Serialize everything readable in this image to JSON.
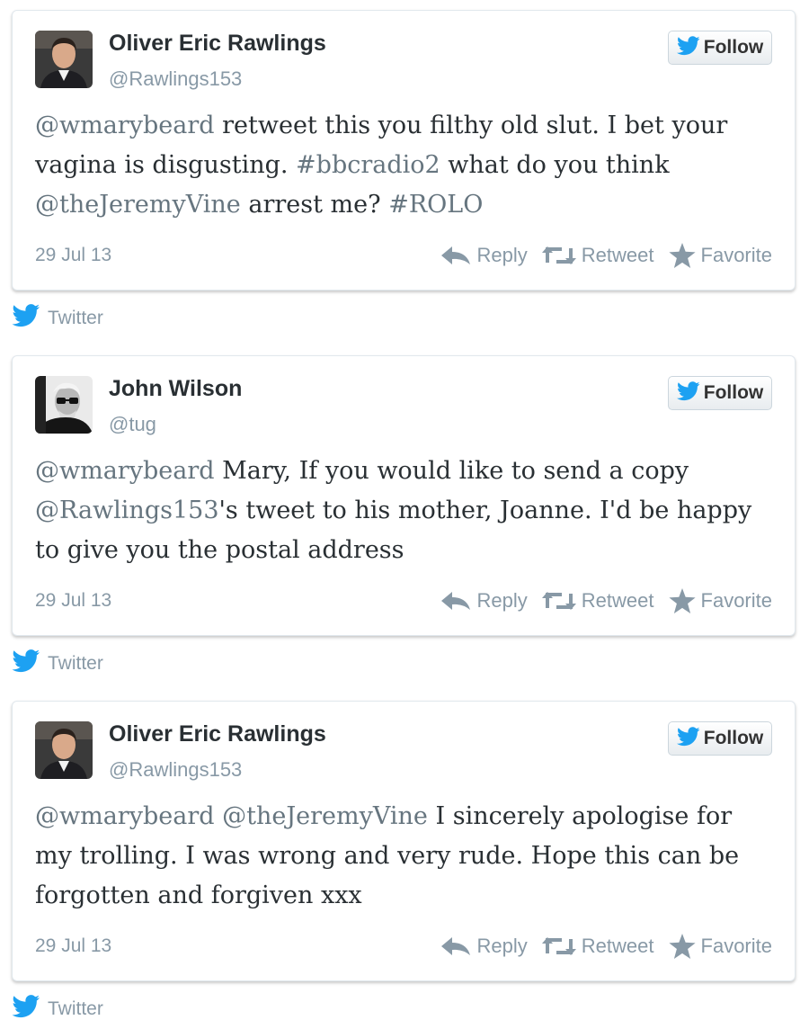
{
  "colors": {
    "twitter_blue": "#1da1f2",
    "text": "#292f33",
    "muted": "#8899a6",
    "link_gray": "#66757f"
  },
  "tweets": [
    {
      "name": "Oliver Eric Rawlings",
      "handle": "@Rawlings153",
      "follow_label": "Follow",
      "segments": [
        {
          "t": "@wmarybeard",
          "k": "mention"
        },
        {
          "t": " retweet this you filthy old slut. I bet your vagina is disgusting. ",
          "k": "plain"
        },
        {
          "t": "#bbcradio2",
          "k": "hashtag"
        },
        {
          "t": " what do you think ",
          "k": "plain"
        },
        {
          "t": "@theJeremyVine",
          "k": "mention"
        },
        {
          "t": " arrest me? ",
          "k": "plain"
        },
        {
          "t": "#ROLO",
          "k": "hashtag"
        }
      ],
      "date": "29 Jul 13",
      "reply_label": "Reply",
      "retweet_label": "Retweet",
      "favorite_label": "Favorite",
      "source_label": "Twitter",
      "avatar_icon": "young-man-avatar"
    },
    {
      "name": "John Wilson",
      "handle": "@tug",
      "follow_label": "Follow",
      "segments": [
        {
          "t": "@wmarybeard",
          "k": "mention"
        },
        {
          "t": " Mary, If you would like to send a copy ",
          "k": "plain"
        },
        {
          "t": "@Rawlings153",
          "k": "mention"
        },
        {
          "t": "'s tweet to his mother, Joanne. I'd be happy to give you the postal address",
          "k": "plain"
        }
      ],
      "date": "29 Jul 13",
      "reply_label": "Reply",
      "retweet_label": "Retweet",
      "favorite_label": "Favorite",
      "source_label": "Twitter",
      "avatar_icon": "bw-man-glasses-avatar"
    },
    {
      "name": "Oliver Eric Rawlings",
      "handle": "@Rawlings153",
      "follow_label": "Follow",
      "segments": [
        {
          "t": "@wmarybeard",
          "k": "mention"
        },
        {
          "t": " ",
          "k": "plain"
        },
        {
          "t": "@theJeremyVine",
          "k": "mention"
        },
        {
          "t": " I sincerely apologise for my trolling. I was wrong and very rude. Hope this can be forgotten and forgiven xxx",
          "k": "plain"
        }
      ],
      "date": "29 Jul 13",
      "reply_label": "Reply",
      "retweet_label": "Retweet",
      "favorite_label": "Favorite",
      "source_label": "Twitter",
      "avatar_icon": "young-man-avatar"
    }
  ]
}
